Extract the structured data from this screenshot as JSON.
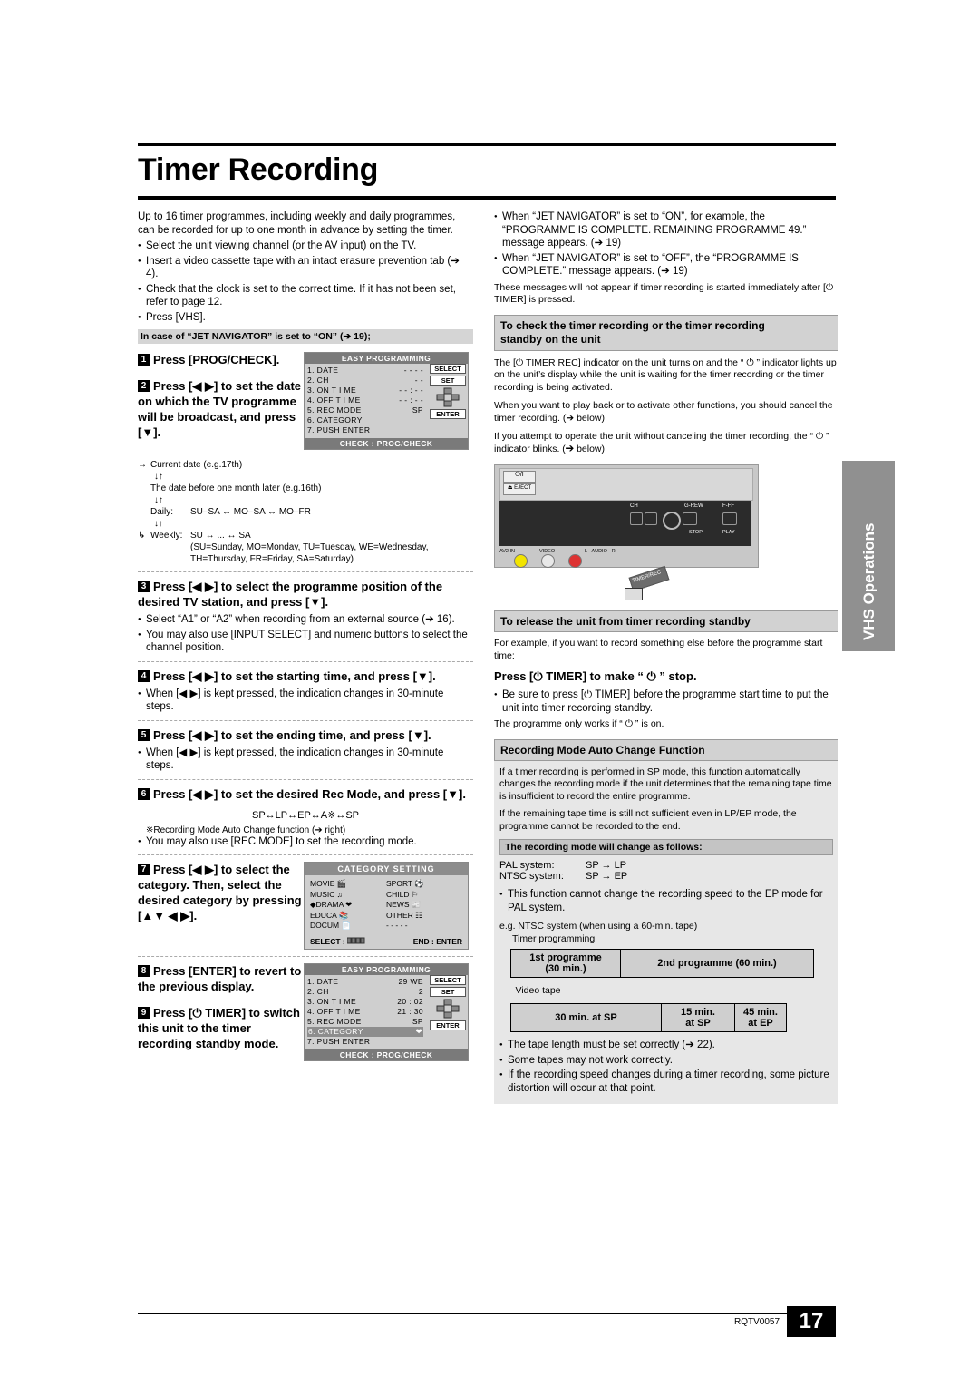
{
  "page": {
    "title": "Timer Recording",
    "footer_code": "RQTV0057",
    "page_number": "17",
    "side_tab": "VHS Operations"
  },
  "intro": {
    "line1": "Up to 16 timer programmes, including weekly and daily programmes,",
    "line2": "can be recorded for up to one month in advance by setting the timer.",
    "b1": "Select the unit viewing channel (or the AV input) on the TV.",
    "b2": "Insert a video cassette tape with an intact erasure prevention tab (➔ 4).",
    "b3": "Check that the clock is set to the correct time. If it has not been set, refer to page 12.",
    "b4": "Press [VHS].",
    "jet_heading": "In case of “JET NAVIGATOR” is set to “ON” (➔ 19);"
  },
  "steps": [
    {
      "num": "1",
      "text": "Press [PROG/CHECK]."
    },
    {
      "num": "2",
      "text": "Press [◀ ▶] to set the date on which the TV programme will be broadcast, and press [▼]."
    },
    {
      "num": "3",
      "text": "Press [◀ ▶] to select the programme position of the desired TV station, and press [▼].",
      "bullets": [
        "Select “A1” or “A2” when recording from an external source (➔ 16).",
        "You may also use [INPUT SELECT] and numeric buttons to select the channel position."
      ]
    },
    {
      "num": "4",
      "text": "Press [◀ ▶] to set the starting time, and press [▼].",
      "bullets": [
        "When [◀ ▶] is kept pressed, the indication changes in 30-minute steps."
      ]
    },
    {
      "num": "5",
      "text": "Press [◀ ▶] to set the ending time, and press [▼].",
      "bullets": [
        "When [◀ ▶] is kept pressed, the indication changes in 30-minute steps."
      ]
    },
    {
      "num": "6",
      "text": "Press [◀ ▶] to set the desired Rec Mode, and press [▼].",
      "diagram": "SP↔LP↔EP↔A※↔SP",
      "bullets": [
        "※Recording Mode Auto Change function (➔ right)",
        "You may also use [REC MODE] to set the recording mode."
      ]
    },
    {
      "num": "7",
      "text": "Press [◀ ▶] to select the category. Then, select the desired category by pressing [▲▼ ◀ ▶]."
    },
    {
      "num": "8",
      "text": "Press [ENTER] to revert to the previous display."
    },
    {
      "num": "9",
      "text": "Press [⏻ TIMER] to switch this unit to the timer recording standby mode."
    }
  ],
  "date_diagram": {
    "l1": "Current date (e.g.17th)",
    "l2": "The date before one month later (e.g.16th)",
    "l3_label": "Daily:",
    "l3": "SU–SA ↔ MO–SA ↔ MO–FR",
    "l4_label": "Weekly:",
    "l4": "SU ↔ ... ↔ SA",
    "note1": "(SU=Sunday, MO=Monday, TU=Tuesday, WE=Wednesday,",
    "note2": "TH=Thursday, FR=Friday, SA=Saturday)"
  },
  "osd1": {
    "head": "EASY PROGRAMMING",
    "rows": [
      {
        "label": "1. DATE",
        "value": "- - - -"
      },
      {
        "label": "2. CH",
        "value": "- -"
      },
      {
        "label": "3. ON  T I ME",
        "value": "- - : - -"
      },
      {
        "label": "4. OFF  T I ME",
        "value": "- - : - -"
      },
      {
        "label": "5. REC MODE",
        "value": "SP"
      },
      {
        "label": "6. CATEGORY",
        "value": ""
      },
      {
        "label": "7. PUSH  ENTER",
        "value": ""
      }
    ],
    "select": "SELECT",
    "set": "SET",
    "enter": "ENTER",
    "foot": "CHECK : PROG/CHECK"
  },
  "osd2": {
    "head": "EASY PROGRAMMING",
    "rows": [
      {
        "label": "1. DATE",
        "value": "29 WE"
      },
      {
        "label": "2. CH",
        "value": "2"
      },
      {
        "label": "3. ON  T I ME",
        "value": "20 : 02"
      },
      {
        "label": "4. OFF  T I ME",
        "value": "21 : 30"
      },
      {
        "label": "5. REC MODE",
        "value": "SP"
      },
      {
        "label": "6. CATEGORY",
        "value": ""
      },
      {
        "label": "7. PUSH  ENTER",
        "value": ""
      }
    ],
    "select": "SELECT",
    "set": "SET",
    "enter": "ENTER",
    "foot": "CHECK : PROG/CHECK"
  },
  "category_box": {
    "head": "CATEGORY  SETTING",
    "items_left": [
      "MOVIE",
      "MUSIC",
      "DRAMA",
      "EDUCA",
      "DOCUM"
    ],
    "items_right": [
      "SPORT",
      "CHILD",
      "NEWS",
      "OTHER",
      "- - - - -"
    ],
    "select_label": "SELECT :",
    "end_label": "END : ENTER"
  },
  "right": {
    "jet_b1": "When “JET NAVIGATOR” is set to “ON”, for example, the “PROGRAMME IS COMPLETE. REMAINING PROGRAMME 49.” message appears. (➔ 19)",
    "jet_b2": "When “JET NAVIGATOR” is set to “OFF”, the “PROGRAMME IS COMPLETE.” message appears. (➔ 19)",
    "jet_note": "These messages will not appear if timer recording is started immediately after [⏻ TIMER] is pressed.",
    "check_heading_l1": "To check the timer recording or the timer recording",
    "check_heading_l2": "standby on the unit",
    "check_p1": "The [⏻ TIMER REC] indicator on the unit turns on and the “ ⏻ ” indicator lights up on the unit’s display while the unit is waiting for the timer recording or the timer recording is being activated.",
    "check_p2": "When you want to play back or to activate other functions, you should cancel the timer recording. (➔ below)",
    "check_p3": "If you attempt to operate the unit without canceling the timer recording, the “ ⏻ ” indicator blinks. (➔ below)",
    "release_heading": "To release the unit from timer recording standby",
    "release_p": "For example, if you want to record something else before the programme start time:",
    "release_press": "Press [⏻ TIMER] to make “ ⏻ ” stop.",
    "release_b1": "Be sure to press [⏻ TIMER] before the programme start time to put the unit into timer recording standby.",
    "release_p2": "The programme only works if “ ⏻ ” is on.",
    "auto_heading": "Recording Mode Auto Change Function",
    "auto_p1": "If a timer recording is performed in SP mode, this function automatically changes the recording mode if the unit determines that the remaining tape time is insufficient to record the entire programme.",
    "auto_p2": "If the remaining tape time is still not sufficient even in LP/EP mode, the programme cannot be recorded to the end.",
    "auto_sub": "The recording mode will change as follows:",
    "auto_rows": [
      {
        "label": "PAL system:",
        "value": "SP → LP"
      },
      {
        "label": "NTSC system:",
        "value": "SP → EP"
      }
    ],
    "auto_b1": "This function cannot change the recording speed to the EP mode for PAL system.",
    "eg_label": "e.g. NTSC system (when using a 60-min. tape)",
    "eg_sub": "Timer programming",
    "prog1_l1": "1st programme",
    "prog1_l2": "(30 min.)",
    "prog2": "2nd programme (60 min.)",
    "videotape": "Video tape",
    "cell_sp": "30 min. at SP",
    "cell_15_l1": "15 min.",
    "cell_15_l2": "at SP",
    "cell_45_l1": "45 min.",
    "cell_45_l2": "at EP",
    "foot_b1": "The tape length must be set correctly (➔ 22).",
    "foot_b2": "Some tapes may not work correctly.",
    "foot_b3": "If the recording speed changes during a timer recording, some picture distortion will occur at that point."
  },
  "device": {
    "label_power": "⏻/I",
    "label_eject": "⏏ EJECT",
    "label_ch": "CH",
    "label_rew": "G-REW",
    "label_ff": "F-FF",
    "label_avin": "AV2 IN",
    "label_video": "VIDEO",
    "label_audio": "L - AUDIO - R",
    "label_timerec": "TIMER/REC"
  }
}
